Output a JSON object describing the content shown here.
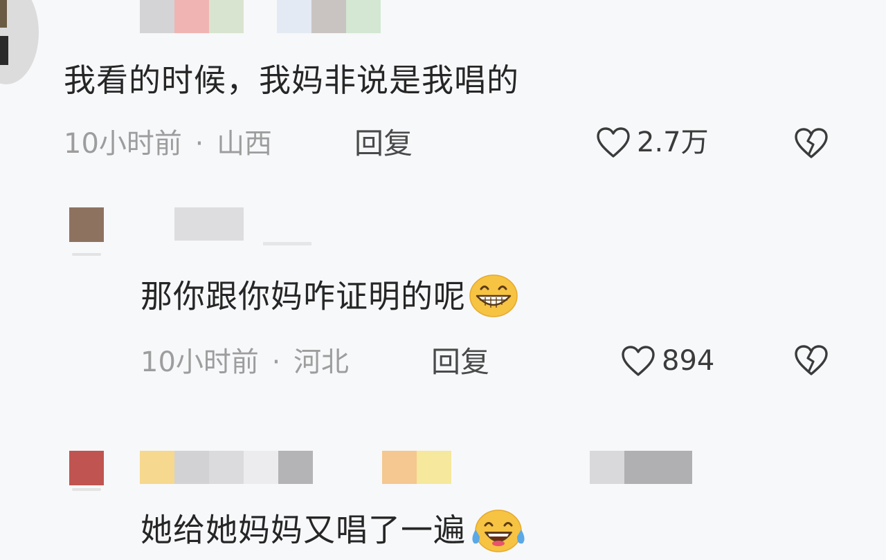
{
  "comments": [
    {
      "text": "我看的时候，我妈非说是我唱的",
      "time": "10小时前",
      "dot": "·",
      "region": "山西",
      "reply_label": "回复",
      "likes": "2.7万"
    },
    {
      "text": "那你跟你妈咋证明的呢",
      "emoji": "grinning-face-emoji",
      "time": "10小时前",
      "dot": "·",
      "region": "河北",
      "reply_label": "回复",
      "likes": "894"
    },
    {
      "text": "她给她妈妈又唱了一遍",
      "emoji": "tears-of-joy-emoji"
    }
  ],
  "colors": {
    "background": "#f7f8fa",
    "text": "#262626",
    "meta": "#9d9d9d",
    "emoji_yellow": "#f6c343",
    "tear_blue": "#5aa9e6"
  },
  "icons": [
    "heart-outline-icon",
    "broken-heart-icon"
  ]
}
